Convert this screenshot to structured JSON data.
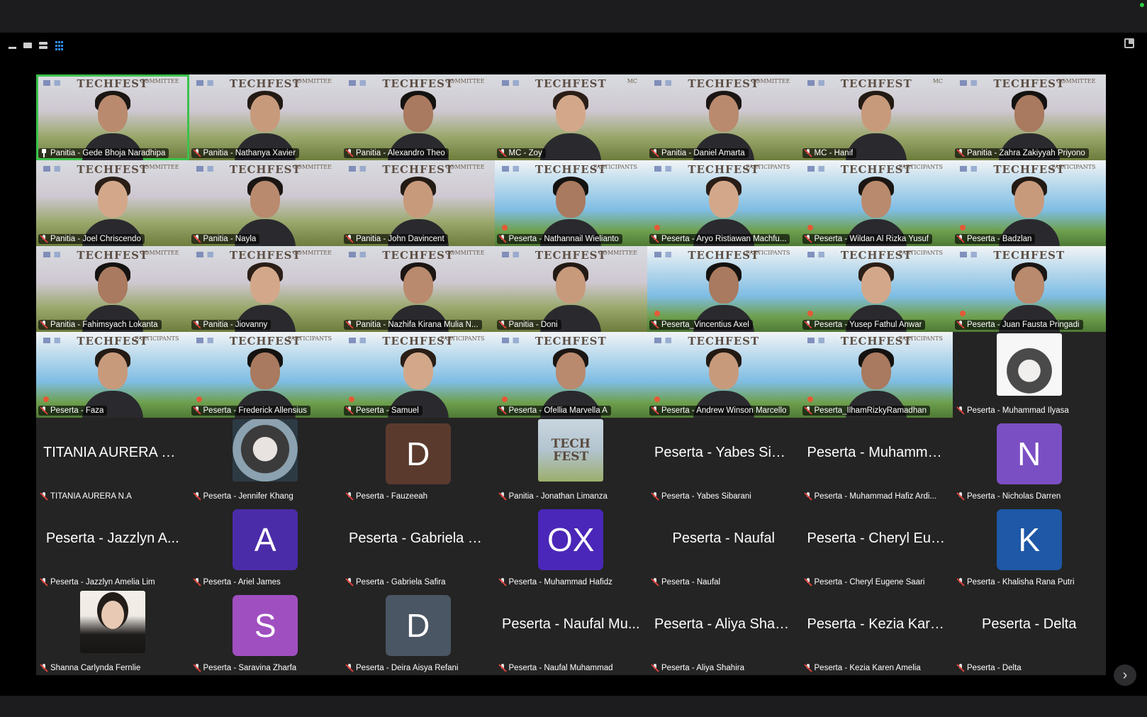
{
  "toolbar": {
    "view_icons": [
      "minimize-icon",
      "speaker-view-icon",
      "strip-view-icon",
      "gallery-view-icon"
    ],
    "active_view": "gallery",
    "fullscreen_icon": "exit-fullscreen-icon"
  },
  "colors": {
    "active_speaker_border": "#3cc24c",
    "muted_icon": "#e0413a",
    "tile_background": "#242424",
    "selected_view": "#2d8cff"
  },
  "banner_text": "TECHFEST",
  "tiles": [
    {
      "name": "Panitia - Gede Bhoja Naradhipa",
      "kind": "video",
      "bg": "committee",
      "tag": "COMMITTEE",
      "icon": "pin",
      "active": true
    },
    {
      "name": "Panitia - Nathanya Xavier",
      "kind": "video",
      "bg": "committee",
      "tag": "COMMITTEE",
      "icon": "mic"
    },
    {
      "name": "Panitia - Alexandro Theo",
      "kind": "video",
      "bg": "committee",
      "tag": "COMMITTEE",
      "icon": "mic"
    },
    {
      "name": "MC - Zoy",
      "kind": "video",
      "bg": "committee",
      "tag": "MC",
      "icon": "mic"
    },
    {
      "name": "Panitia - Daniel Amarta",
      "kind": "video",
      "bg": "committee",
      "tag": "COMMITTEE",
      "icon": "mic"
    },
    {
      "name": "MC - Hanif",
      "kind": "video",
      "bg": "committee",
      "tag": "MC",
      "icon": "mic"
    },
    {
      "name": "Panitia - Zahra Zakiyyah Priyono",
      "kind": "video",
      "bg": "committee",
      "tag": "COMMITTEE",
      "icon": "mic"
    },
    {
      "name": "Panitia - Joel Chriscendo",
      "kind": "video",
      "bg": "committee",
      "tag": "COMMITTEE",
      "icon": "mic"
    },
    {
      "name": "Panitia - Nayla",
      "kind": "video",
      "bg": "committee",
      "tag": "COMMITTEE",
      "icon": "mic"
    },
    {
      "name": "Panitia - John Davincent",
      "kind": "video",
      "bg": "committee",
      "tag": "COMMITTEE",
      "icon": "mic"
    },
    {
      "name": "Peserta - Nathannail Wielianto",
      "kind": "video",
      "bg": "participants",
      "tag": "PARTICIPANTS",
      "icon": "mic"
    },
    {
      "name": "Peserta - Aryo Ristiawan Machfu...",
      "kind": "video",
      "bg": "participants",
      "tag": "PARTICIPANTS",
      "icon": "mic"
    },
    {
      "name": "Peserta - Wildan Al Rizka Yusuf",
      "kind": "video",
      "bg": "participants",
      "tag": "PARTICIPANTS",
      "icon": "mic"
    },
    {
      "name": "Peserta - Badzlan",
      "kind": "video",
      "bg": "participants",
      "tag": "PARTICIPANTS",
      "icon": "mic"
    },
    {
      "name": "Panitia - Fahimsyach Lokanta",
      "kind": "video",
      "bg": "committee",
      "tag": "COMMITTEE",
      "icon": "mic"
    },
    {
      "name": "Panitia - Jiovanny",
      "kind": "video",
      "bg": "committee",
      "tag": "COMMITTEE",
      "icon": "mic"
    },
    {
      "name": "Panitia -  Nazhifa Kirana Mulia N...",
      "kind": "video",
      "bg": "committee",
      "tag": "COMMITTEE",
      "icon": "mic"
    },
    {
      "name": "Panitia - Doni",
      "kind": "video",
      "bg": "committee",
      "tag": "COMMITTEE",
      "icon": "mic"
    },
    {
      "name": "Peserta_Vincentius Axel",
      "kind": "video",
      "bg": "participants",
      "tag": "PARTICIPANTS",
      "icon": "mic"
    },
    {
      "name": "Peserta - Yusep Fathul Anwar",
      "kind": "video",
      "bg": "participants",
      "tag": "PARTICIPANTS",
      "icon": "mic"
    },
    {
      "name": "Peserta - Juan Fausta Pringadi",
      "kind": "video",
      "bg": "participants",
      "tag": "",
      "icon": "mic"
    },
    {
      "name": "Peserta - Faza",
      "kind": "video",
      "bg": "participants",
      "tag": "PARTICIPANTS",
      "icon": "mic"
    },
    {
      "name": "Peserta - Frederick Allensius",
      "kind": "video",
      "bg": "participants",
      "tag": "PARTICIPANTS",
      "icon": "mic"
    },
    {
      "name": "Peserta - Samuel",
      "kind": "video",
      "bg": "participants",
      "tag": "PARTICIPANTS",
      "icon": "mic"
    },
    {
      "name": "Peserta - Ofellia Marvella A",
      "kind": "video",
      "bg": "participants",
      "tag": "",
      "icon": "mic"
    },
    {
      "name": "Peserta - Andrew Winson Marcello",
      "kind": "video",
      "bg": "participants",
      "tag": "",
      "icon": "mic"
    },
    {
      "name": "Peserta_IlhamRizkyRamadhan",
      "kind": "video",
      "bg": "participants",
      "tag": "PARTICIPANTS",
      "icon": "mic"
    },
    {
      "name": "Peserta - Muhammad Ilyasa",
      "kind": "photo",
      "photo": "anime2",
      "icon": "mic"
    },
    {
      "name": "TITANIA AURERA N.A",
      "kind": "text",
      "display": "TITANIA AURERA N.A",
      "icon": "mic"
    },
    {
      "name": "Peserta - Jennifer Khang",
      "kind": "photo",
      "photo": "anime",
      "icon": "mic"
    },
    {
      "name": "Peserta - Fauzeeah",
      "kind": "avatar",
      "initial": "D",
      "color": "#5b3a2e",
      "icon": "mic"
    },
    {
      "name": "Panitia - Jonathan Limanza",
      "kind": "photo",
      "photo": "logo-img",
      "photo_text": "TECH FEST",
      "icon": "mic"
    },
    {
      "name": "Peserta - Yabes Sibarani",
      "kind": "text",
      "display": "Peserta - Yabes Siba...",
      "icon": "mic"
    },
    {
      "name": "Peserta - Muhammad Hafiz Ardi...",
      "kind": "text",
      "display": "Peserta - Muhamma...",
      "icon": "mic"
    },
    {
      "name": "Peserta - Nicholas Darren",
      "kind": "avatar",
      "initial": "N",
      "color": "#7b4fc4",
      "icon": "mic"
    },
    {
      "name": "Peserta - Jazzlyn Amelia Lim",
      "kind": "text",
      "display": "Peserta - Jazzlyn A...",
      "icon": "mic"
    },
    {
      "name": "Peserta - Ariel James",
      "kind": "avatar",
      "initial": "A",
      "color": "#4b2ca8",
      "icon": "mic"
    },
    {
      "name": "Peserta - Gabriela Safira",
      "kind": "text",
      "display": "Peserta - Gabriela S...",
      "icon": "mic"
    },
    {
      "name": "Peserta - Muhammad Hafidz",
      "kind": "avatar",
      "initial": "OX",
      "color": "#4a27b8",
      "icon": "mic"
    },
    {
      "name": "Peserta - Naufal",
      "kind": "text",
      "display": "Peserta - Naufal",
      "icon": "mic"
    },
    {
      "name": "Peserta - Cheryl Eugene Saari",
      "kind": "text",
      "display": "Peserta - Cheryl Eug...",
      "icon": "mic"
    },
    {
      "name": "Peserta - Khalisha Rana Putri",
      "kind": "avatar",
      "initial": "K",
      "color": "#1e58a6",
      "icon": "mic"
    },
    {
      "name": "Shanna Carlynda Fernlie",
      "kind": "photo",
      "photo": "portrait",
      "icon": "mic"
    },
    {
      "name": "Peserta - Saravina Zharfa",
      "kind": "avatar",
      "initial": "S",
      "color": "#a04fc0",
      "icon": "mic"
    },
    {
      "name": "Peserta - Deira Aisya Refani",
      "kind": "avatar",
      "initial": "D",
      "color": "#4a5663",
      "icon": "mic"
    },
    {
      "name": "Peserta - Naufal Muhammad",
      "kind": "text",
      "display": "Peserta - Naufal Mu...",
      "icon": "mic"
    },
    {
      "name": "Peserta - Aliya Shahira",
      "kind": "text",
      "display": "Peserta - Aliya Shahira",
      "icon": "mic"
    },
    {
      "name": "Peserta - Kezia Karen Amelia",
      "kind": "text",
      "display": "Peserta - Kezia Kare...",
      "icon": "mic"
    },
    {
      "name": "Peserta - Delta",
      "kind": "text",
      "display": "Peserta - Delta",
      "icon": "mic"
    }
  ],
  "pagination": {
    "next_icon": "chevron-right-icon",
    "next_glyph": "›"
  }
}
